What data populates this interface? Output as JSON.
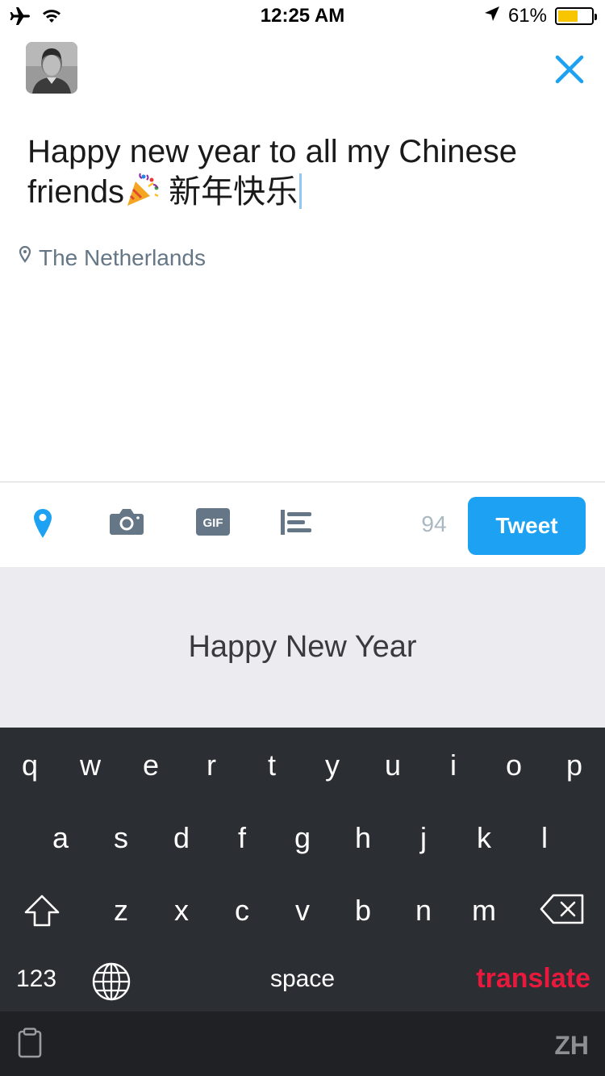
{
  "status_bar": {
    "time": "12:25 AM",
    "battery_percent_label": "61%",
    "battery_level": 0.61,
    "icons": [
      "airplane-icon",
      "wifi-icon",
      "location-arrow-icon",
      "battery-icon"
    ]
  },
  "compose": {
    "avatar_icon": "user-avatar",
    "close_icon": "close-icon",
    "text_line1": "Happy new year to all my Chinese",
    "text_line2_prefix": "friends",
    "text_emoji": "party-popper-emoji",
    "text_line2_suffix": " 新年快乐",
    "location": "The Netherlands"
  },
  "toolbar": {
    "icons": [
      "location-pin-icon",
      "camera-icon",
      "gif-icon",
      "poll-icon"
    ],
    "gif_label": "GIF",
    "char_count": "94",
    "tweet_label": "Tweet",
    "accent_color": "#1da1f2"
  },
  "suggestion": {
    "text": "Happy New Year"
  },
  "keyboard": {
    "row1": [
      "q",
      "w",
      "e",
      "r",
      "t",
      "y",
      "u",
      "i",
      "o",
      "p"
    ],
    "row2": [
      "a",
      "s",
      "d",
      "f",
      "g",
      "h",
      "j",
      "k",
      "l"
    ],
    "row3": [
      "z",
      "x",
      "c",
      "v",
      "b",
      "n",
      "m"
    ],
    "numbers_label": "123",
    "space_label": "space",
    "translate_label": "translate",
    "translate_color": "#e8193c",
    "language_label": "ZH",
    "icons": [
      "shift-icon",
      "backspace-icon",
      "globe-icon",
      "clipboard-icon"
    ]
  }
}
